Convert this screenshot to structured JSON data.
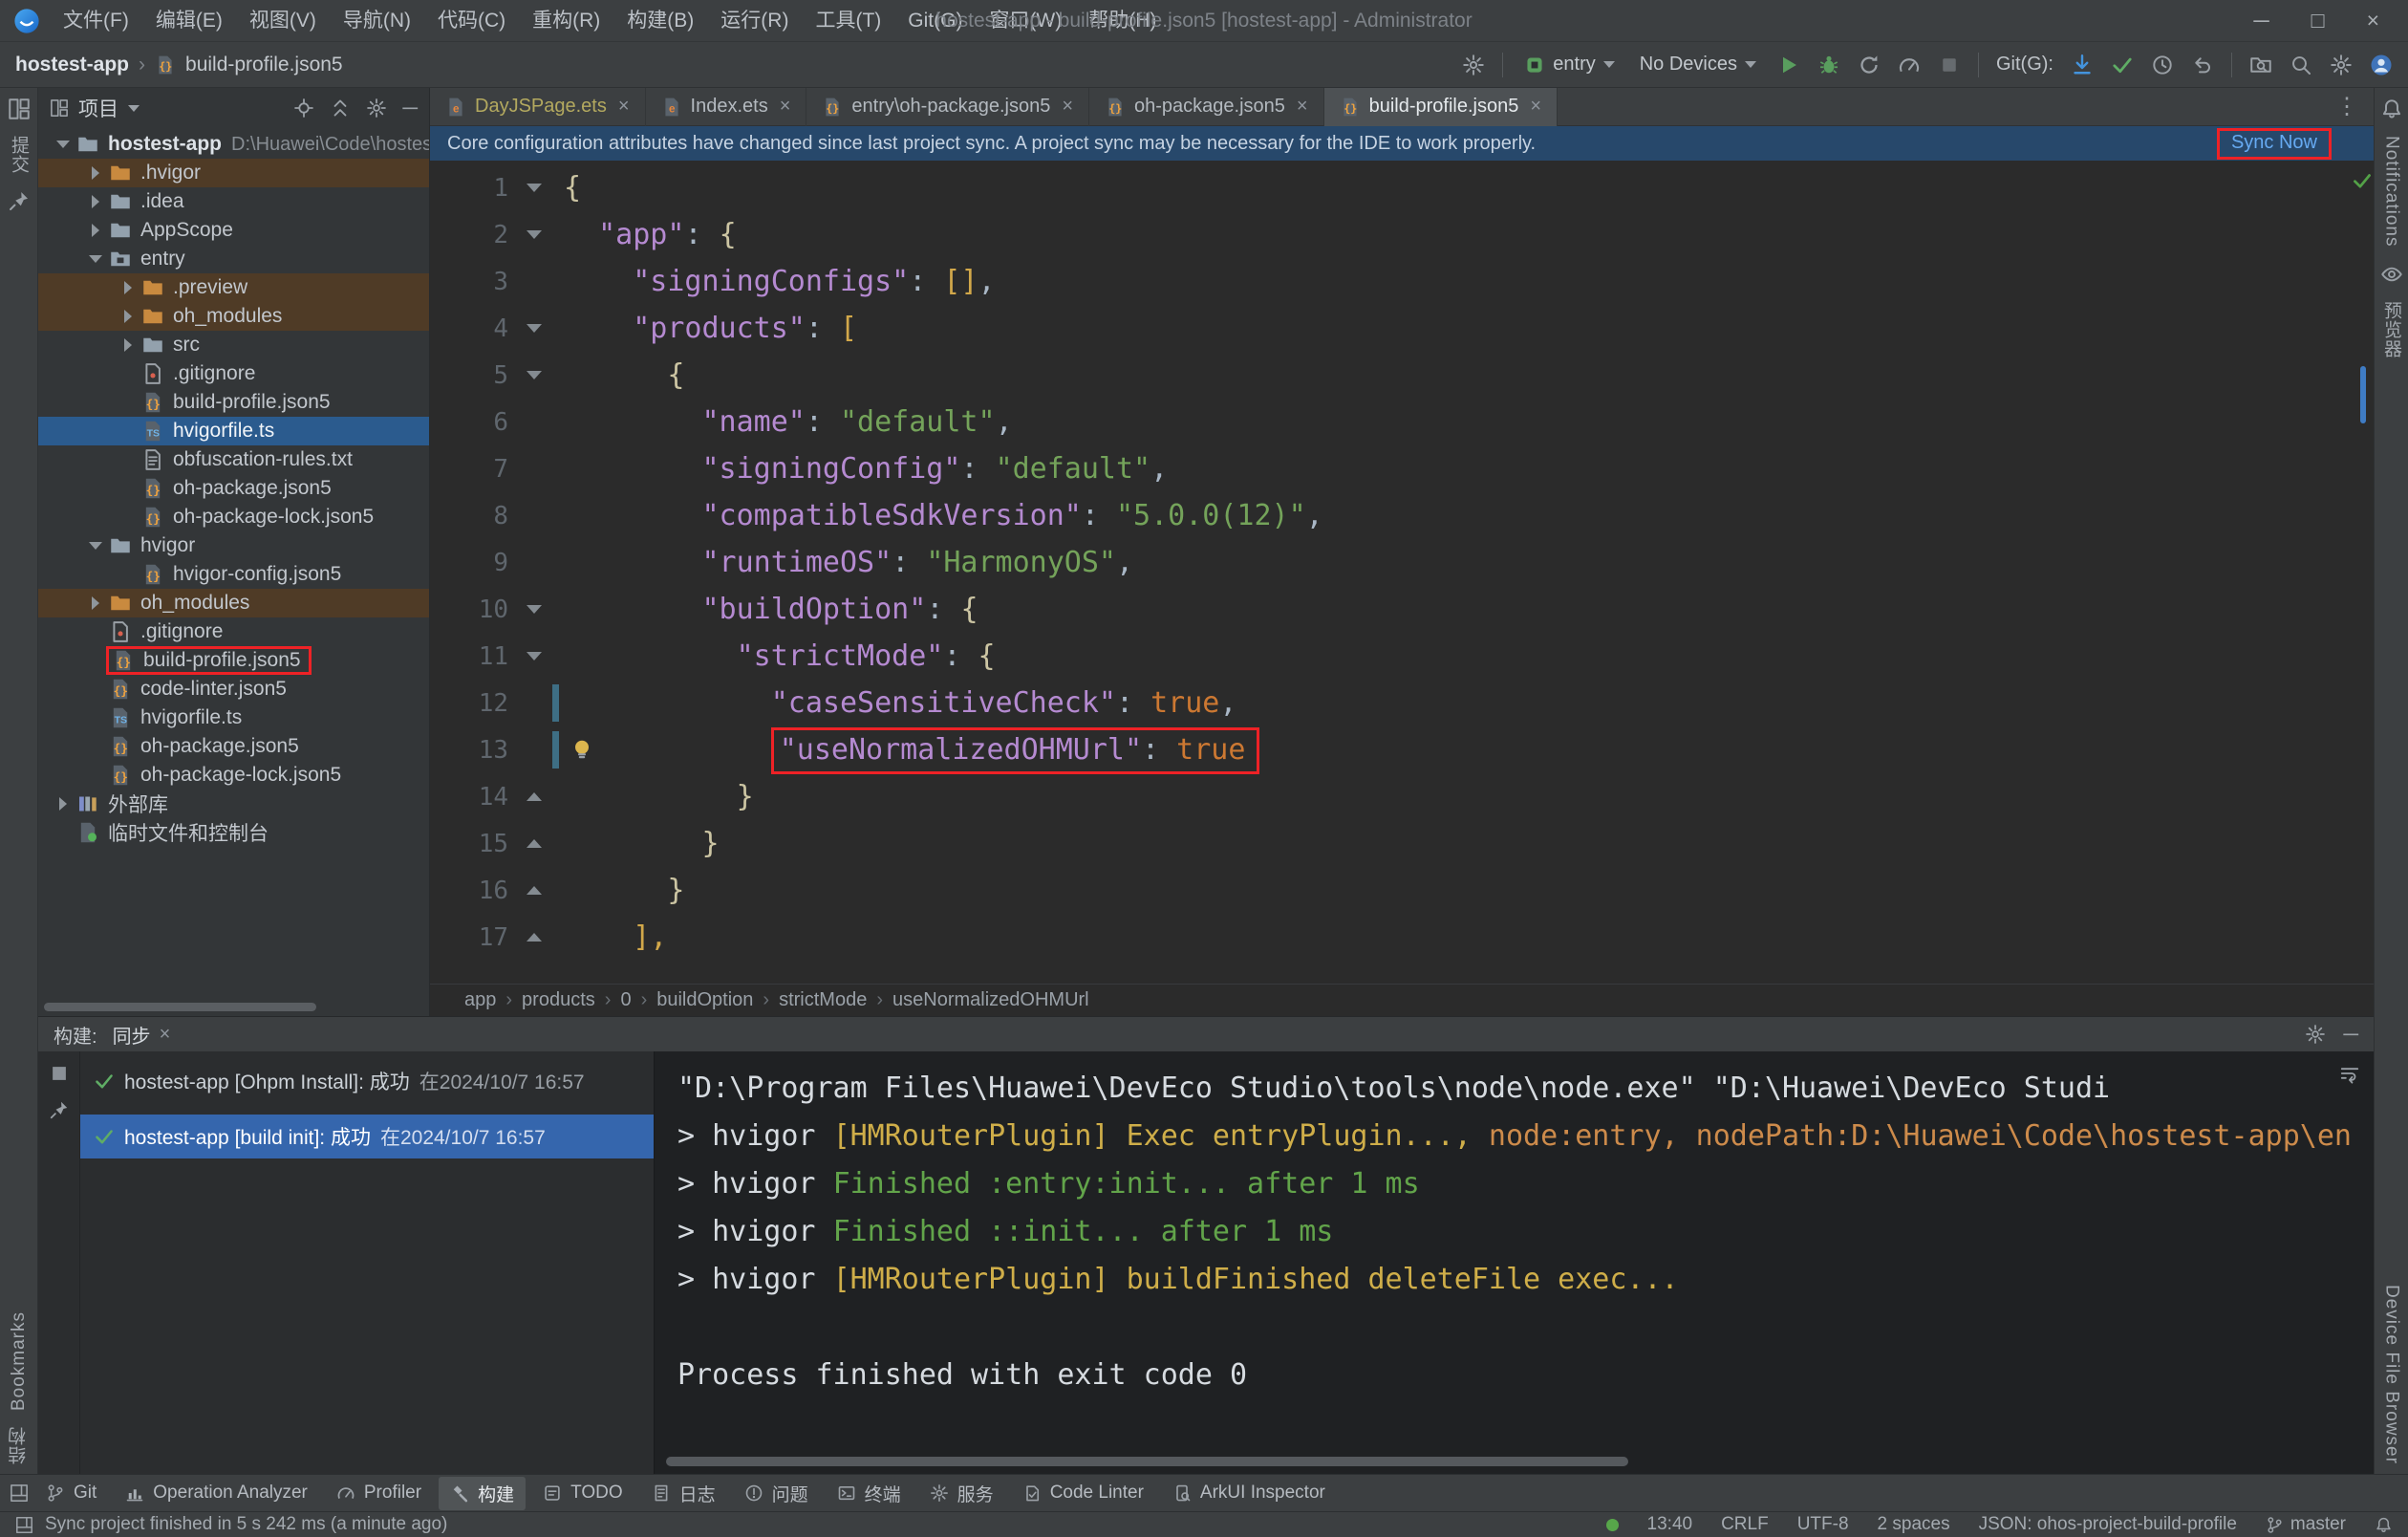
{
  "window": {
    "title": "hostest-app - build-profile.json5 [hostest-app] - Administrator",
    "menus": [
      "文件(F)",
      "编辑(E)",
      "视图(V)",
      "导航(N)",
      "代码(C)",
      "重构(R)",
      "构建(B)",
      "运行(R)",
      "工具(T)",
      "Git(G)",
      "窗口(W)",
      "帮助(H)"
    ],
    "controls": {
      "minimize": "─",
      "maximize": "□",
      "close": "×"
    }
  },
  "ui": {
    "close_glyph": "×",
    "crumb_sep": "›",
    "more_glyph": "⋮",
    "minimize_glyph": "─"
  },
  "toolbar": {
    "project_crumb": "hostest-app",
    "file_crumb": "build-profile.json5",
    "run_config": "entry",
    "device_selector": "No Devices",
    "git_label": "Git(G):"
  },
  "left_stripe": {
    "commit": "提交",
    "bookmarks": "Bookmarks",
    "structure": "结构"
  },
  "right_stripe": {
    "notifications": "Notifications",
    "previewer": "预览器",
    "device_file_browser": "Device File Browser"
  },
  "project": {
    "title": "项目",
    "tree": [
      {
        "label": "hostest-app",
        "sub": "D:\\Huawei\\Code\\hostest-a",
        "level": 0,
        "icon": "folder",
        "chev": "down",
        "bold": true
      },
      {
        "label": ".hvigor",
        "level": 1,
        "icon": "folder_x",
        "chev": "right",
        "excluded": true
      },
      {
        "label": ".idea",
        "level": 1,
        "icon": "folder",
        "chev": "right"
      },
      {
        "label": "AppScope",
        "level": 1,
        "icon": "folder",
        "chev": "right"
      },
      {
        "label": "entry",
        "level": 1,
        "icon": "module",
        "chev": "down"
      },
      {
        "label": ".preview",
        "level": 2,
        "icon": "folder_x",
        "chev": "right",
        "excluded": true
      },
      {
        "label": "oh_modules",
        "level": 2,
        "icon": "folder_x",
        "chev": "right",
        "excluded": true
      },
      {
        "label": "src",
        "level": 2,
        "icon": "folder",
        "chev": "right"
      },
      {
        "label": ".gitignore",
        "level": 2,
        "icon": "git"
      },
      {
        "label": "build-profile.json5",
        "level": 2,
        "icon": "json5"
      },
      {
        "label": "hvigorfile.ts",
        "level": 2,
        "icon": "ts",
        "selected": true
      },
      {
        "label": "obfuscation-rules.txt",
        "level": 2,
        "icon": "txt"
      },
      {
        "label": "oh-package.json5",
        "level": 2,
        "icon": "json5"
      },
      {
        "label": "oh-package-lock.json5",
        "level": 2,
        "icon": "json5"
      },
      {
        "label": "hvigor",
        "level": 1,
        "icon": "folder",
        "chev": "down"
      },
      {
        "label": "hvigor-config.json5",
        "level": 2,
        "icon": "json5"
      },
      {
        "label": "oh_modules",
        "level": 1,
        "icon": "folder_x",
        "chev": "right",
        "excluded": true
      },
      {
        "label": ".gitignore",
        "level": 1,
        "icon": "git"
      },
      {
        "label": "build-profile.json5",
        "level": 1,
        "icon": "json5",
        "boxed": true
      },
      {
        "label": "code-linter.json5",
        "level": 1,
        "icon": "json5"
      },
      {
        "label": "hvigorfile.ts",
        "level": 1,
        "icon": "ts"
      },
      {
        "label": "oh-package.json5",
        "level": 1,
        "icon": "json5"
      },
      {
        "label": "oh-package-lock.json5",
        "level": 1,
        "icon": "json5"
      },
      {
        "label": "外部库",
        "level": 0,
        "icon": "lib",
        "chev": "right"
      },
      {
        "label": "临时文件和控制台",
        "level": 0,
        "icon": "scratch",
        "chev": ""
      }
    ]
  },
  "tabs": [
    {
      "label": "DayJSPage.ets",
      "icon": "ets",
      "tint": "olive"
    },
    {
      "label": "Index.ets",
      "icon": "ets"
    },
    {
      "label": "entry\\oh-package.json5",
      "icon": "json5"
    },
    {
      "label": "oh-package.json5",
      "icon": "json5"
    },
    {
      "label": "build-profile.json5",
      "icon": "json5",
      "active": true
    }
  ],
  "banner": {
    "message": "Core configuration attributes have changed since last project sync. A project sync may be necessary for the IDE to work properly.",
    "action": "Sync Now"
  },
  "editor": {
    "lines": [
      {
        "n": 1,
        "fold": "down",
        "segs": [
          [
            "{",
            "brace"
          ]
        ]
      },
      {
        "n": 2,
        "fold": "down",
        "segs": [
          [
            "  "
          ],
          [
            "\"app\"",
            "key"
          ],
          [
            ": "
          ],
          [
            "{",
            "brace"
          ]
        ]
      },
      {
        "n": 3,
        "fold": "",
        "segs": [
          [
            "    "
          ],
          [
            "\"signingConfigs\"",
            "key"
          ],
          [
            ": "
          ],
          [
            "[]",
            "bracket"
          ],
          [
            ","
          ]
        ]
      },
      {
        "n": 4,
        "fold": "down",
        "segs": [
          [
            "    "
          ],
          [
            "\"products\"",
            "key"
          ],
          [
            ": "
          ],
          [
            "[",
            "bracket"
          ]
        ]
      },
      {
        "n": 5,
        "fold": "down",
        "segs": [
          [
            "      "
          ],
          [
            "{",
            "brace"
          ]
        ]
      },
      {
        "n": 6,
        "fold": "",
        "segs": [
          [
            "        "
          ],
          [
            "\"name\"",
            "key"
          ],
          [
            ": "
          ],
          [
            "\"default\"",
            "str"
          ],
          [
            ","
          ]
        ]
      },
      {
        "n": 7,
        "fold": "",
        "segs": [
          [
            "        "
          ],
          [
            "\"signingConfig\"",
            "key"
          ],
          [
            ": "
          ],
          [
            "\"default\"",
            "str"
          ],
          [
            ","
          ]
        ]
      },
      {
        "n": 8,
        "fold": "",
        "segs": [
          [
            "        "
          ],
          [
            "\"compatibleSdkVersion\"",
            "key"
          ],
          [
            ": "
          ],
          [
            "\"5.0.0(12)\"",
            "str"
          ],
          [
            ","
          ]
        ]
      },
      {
        "n": 9,
        "fold": "",
        "segs": [
          [
            "        "
          ],
          [
            "\"runtimeOS\"",
            "key"
          ],
          [
            ": "
          ],
          [
            "\"HarmonyOS\"",
            "str"
          ],
          [
            ","
          ]
        ]
      },
      {
        "n": 10,
        "fold": "down",
        "segs": [
          [
            "        "
          ],
          [
            "\"buildOption\"",
            "key"
          ],
          [
            ": "
          ],
          [
            "{",
            "brace"
          ]
        ]
      },
      {
        "n": 11,
        "fold": "down",
        "segs": [
          [
            "          "
          ],
          [
            "\"strictMode\"",
            "key"
          ],
          [
            ": "
          ],
          [
            "{",
            "brace"
          ]
        ]
      },
      {
        "n": 12,
        "fold": "",
        "changed": true,
        "segs": [
          [
            "            "
          ],
          [
            "\"caseSensitiveCheck\"",
            "key"
          ],
          [
            ": "
          ],
          [
            "true",
            "kw"
          ],
          [
            ","
          ]
        ]
      },
      {
        "n": 13,
        "fold": "",
        "changed": true,
        "bulb": true,
        "segs": [
          [
            "            "
          ],
          [
            "\"useNormalizedOHMUrl\"",
            "key",
            "box"
          ],
          [
            ": ",
            "plain",
            "box"
          ],
          [
            "true",
            "kw",
            "box"
          ]
        ]
      },
      {
        "n": 14,
        "fold": "up",
        "segs": [
          [
            "          "
          ],
          [
            "}",
            "brace"
          ]
        ]
      },
      {
        "n": 15,
        "fold": "up",
        "segs": [
          [
            "        "
          ],
          [
            "}",
            "brace"
          ]
        ]
      },
      {
        "n": 16,
        "fold": "up",
        "segs": [
          [
            "      "
          ],
          [
            "}",
            "brace"
          ]
        ]
      },
      {
        "n": 17,
        "fold": "up",
        "segs": [
          [
            "    "
          ],
          [
            "],",
            "bracket"
          ]
        ]
      }
    ],
    "breadcrumbs": [
      "app",
      "products",
      "0",
      "buildOption",
      "strictMode",
      "useNormalizedOHMUrl"
    ]
  },
  "build": {
    "label": "构建:",
    "tab": "同步",
    "items": [
      {
        "name": "hostest-app [Ohpm Install]: 成功",
        "time": "在2024/10/7 16:57",
        "selected": false
      },
      {
        "name": "hostest-app [build init]: 成功",
        "time": "在2024/10/7 16:57",
        "selected": true
      }
    ],
    "console": [
      [
        [
          "\"D:\\Program Files\\Huawei\\DevEco Studio\\tools\\node\\node.exe\" \"D:\\Huawei\\DevEco Studi",
          "plain"
        ]
      ],
      [
        [
          "> hvigor ",
          "plain"
        ],
        [
          "[HMRouterPlugin] Exec entryPlugin..., ",
          "warn"
        ],
        [
          "node:entry, nodePath:D:\\Huawei\\Code\\hostest-app\\en",
          "orange"
        ]
      ],
      [
        [
          "> hvigor ",
          "plain"
        ],
        [
          "Finished :entry:init... after 1 ms",
          "ok"
        ]
      ],
      [
        [
          "> hvigor ",
          "plain"
        ],
        [
          "Finished ::init... after 1 ms",
          "ok"
        ]
      ],
      [
        [
          "> hvigor ",
          "plain"
        ],
        [
          "[HMRouterPlugin] buildFinished deleteFile exec...",
          "warn"
        ]
      ],
      [],
      [
        [
          "Process finished with exit code 0",
          "plain"
        ]
      ]
    ]
  },
  "bottom_bar": {
    "items": [
      {
        "label": "Git",
        "icon": "branch"
      },
      {
        "label": "Operation Analyzer",
        "icon": "chart"
      },
      {
        "label": "Profiler",
        "icon": "gauge"
      },
      {
        "label": "构建",
        "icon": "hammer",
        "active": true
      },
      {
        "label": "TODO",
        "icon": "todo"
      },
      {
        "label": "日志",
        "icon": "log"
      },
      {
        "label": "问题",
        "icon": "problem"
      },
      {
        "label": "终端",
        "icon": "terminal"
      },
      {
        "label": "服务",
        "icon": "services"
      },
      {
        "label": "Code Linter",
        "icon": "linter"
      },
      {
        "label": "ArkUI Inspector",
        "icon": "inspector"
      }
    ]
  },
  "status": {
    "message": "Sync project finished in 5 s 242 ms (a minute ago)",
    "time": "13:40",
    "line_ending": "CRLF",
    "encoding": "UTF-8",
    "indent": "2 spaces",
    "schema": "JSON: ohos-project-build-profile",
    "branch": "master"
  }
}
